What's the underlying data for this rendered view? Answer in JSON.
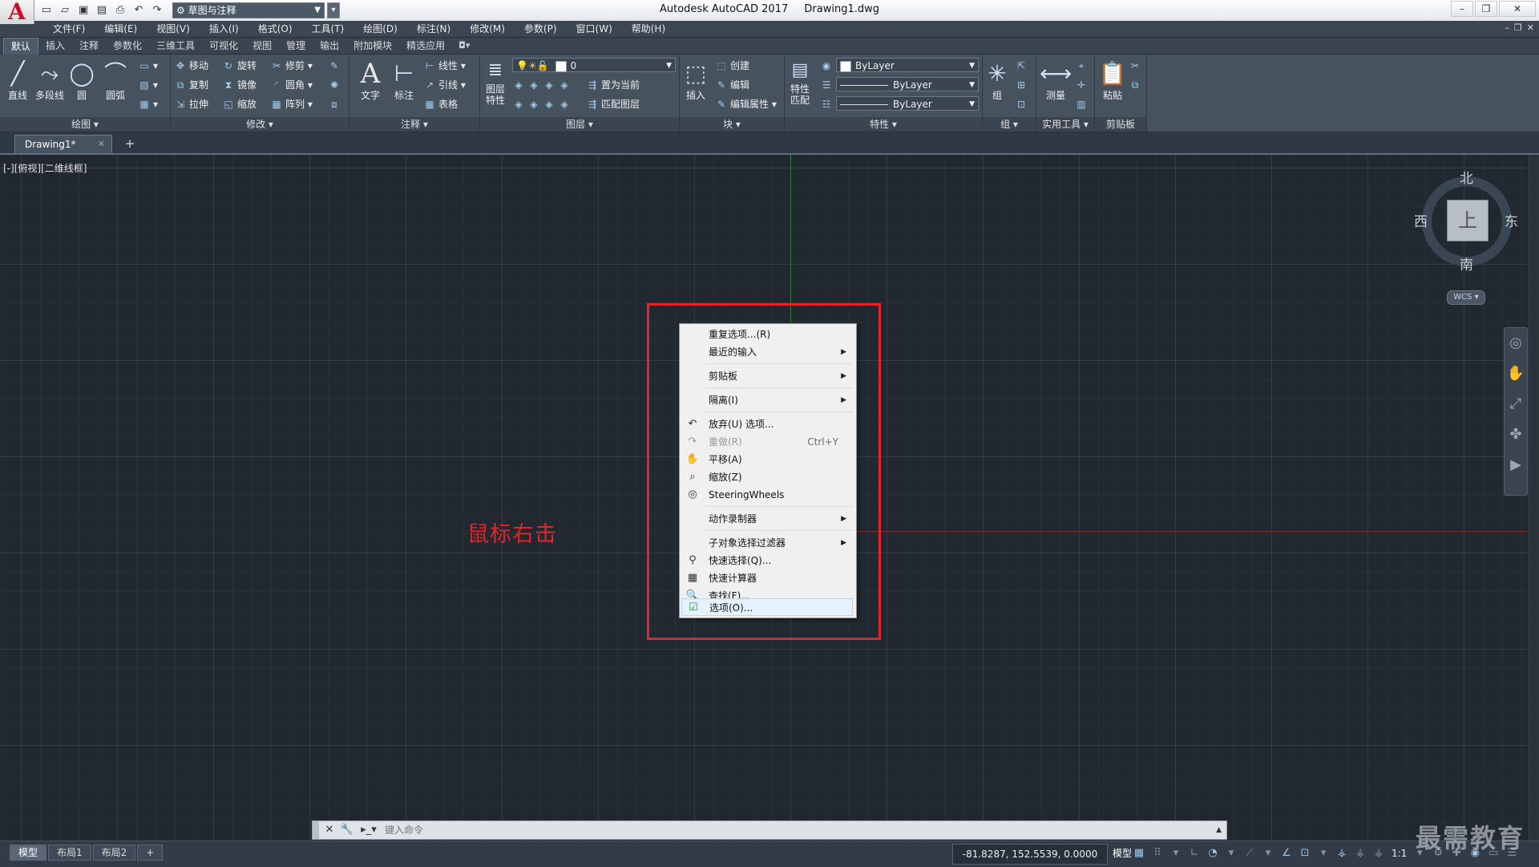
{
  "titlebar": {
    "app_name": "Autodesk AutoCAD 2017",
    "file_name": "Drawing1.dwg",
    "workspace": "草图与注释"
  },
  "menu": [
    "文件(F)",
    "编辑(E)",
    "视图(V)",
    "插入(I)",
    "格式(O)",
    "工具(T)",
    "绘图(D)",
    "标注(N)",
    "修改(M)",
    "参数(P)",
    "窗口(W)",
    "帮助(H)"
  ],
  "ribbon_tabs": [
    "默认",
    "插入",
    "注释",
    "参数化",
    "三维工具",
    "可视化",
    "视图",
    "管理",
    "输出",
    "附加模块",
    "精选应用"
  ],
  "ribbon": {
    "draw": {
      "title": "绘图",
      "tools": [
        "直线",
        "多段线",
        "圆",
        "圆弧"
      ]
    },
    "modify": {
      "title": "修改",
      "tools": [
        "移动",
        "旋转",
        "修剪",
        "复制",
        "镜像",
        "圆角",
        "拉伸",
        "缩放",
        "阵列"
      ]
    },
    "annotation": {
      "title": "注释",
      "text": "文字",
      "dimension": "标注",
      "tools": [
        "线性",
        "引线",
        "表格"
      ]
    },
    "layers": {
      "title": "图层",
      "properties": "图层\n特性",
      "current_layer": "0",
      "tools": [
        "置为当前",
        "匹配图层"
      ]
    },
    "block": {
      "title": "块",
      "insert": "插入",
      "tools": [
        "创建",
        "编辑",
        "编辑属性"
      ]
    },
    "properties": {
      "title": "特性",
      "match": "特性\n匹配",
      "color": "ByLayer",
      "linetype": "ByLayer",
      "lineweight": "ByLayer"
    },
    "groups": {
      "title": "组",
      "group": "组"
    },
    "utilities": {
      "title": "实用工具",
      "measure": "测量"
    },
    "clipboard": {
      "title": "剪贴板",
      "paste": "粘贴"
    }
  },
  "file_tab": "Drawing1*",
  "viewport_label": "[-][俯视][二维线框]",
  "annotation_text": "鼠标右击",
  "context_menu": [
    {
      "label": "重复选项...(R)",
      "icon": "",
      "submenu": false
    },
    {
      "label": "最近的输入",
      "icon": "",
      "submenu": true
    },
    {
      "label": "剪贴板",
      "icon": "",
      "submenu": true
    },
    {
      "label": "隔离(I)",
      "icon": "",
      "submenu": true
    },
    {
      "label": "放弃(U) 选项...",
      "icon": "undo-icon",
      "submenu": false
    },
    {
      "label": "重做(R)",
      "icon": "redo-icon",
      "shortcut": "Ctrl+Y",
      "disabled": true
    },
    {
      "label": "平移(A)",
      "icon": "pan-icon"
    },
    {
      "label": "缩放(Z)",
      "icon": "zoom-icon"
    },
    {
      "label": "SteeringWheels",
      "icon": "steeringwheel-icon"
    },
    {
      "label": "动作录制器",
      "icon": "",
      "submenu": true
    },
    {
      "label": "子对象选择过滤器",
      "icon": "",
      "submenu": true
    },
    {
      "label": "快速选择(Q)...",
      "icon": "quickselect-icon"
    },
    {
      "label": "快速计算器",
      "icon": "calculator-icon"
    },
    {
      "label": "查找(F)...",
      "icon": "find-icon"
    },
    {
      "label": "选项(O)...",
      "icon": "options-icon",
      "highlight": true
    }
  ],
  "viewcube": {
    "north": "北",
    "south": "南",
    "east": "东",
    "west": "西",
    "face": "上",
    "wcs": "WCS"
  },
  "command_line": {
    "placeholder": "键入命令"
  },
  "layout_tabs": [
    "模型",
    "布局1",
    "布局2"
  ],
  "status": {
    "coordinates": "-81.8287, 152.5539, 0.0000",
    "model": "模型",
    "scale": "1:1"
  },
  "watermark": "最需教育",
  "colors": {
    "accent_red": "#e0262a",
    "canvas": "#212830",
    "ribbon": "#47525f"
  }
}
